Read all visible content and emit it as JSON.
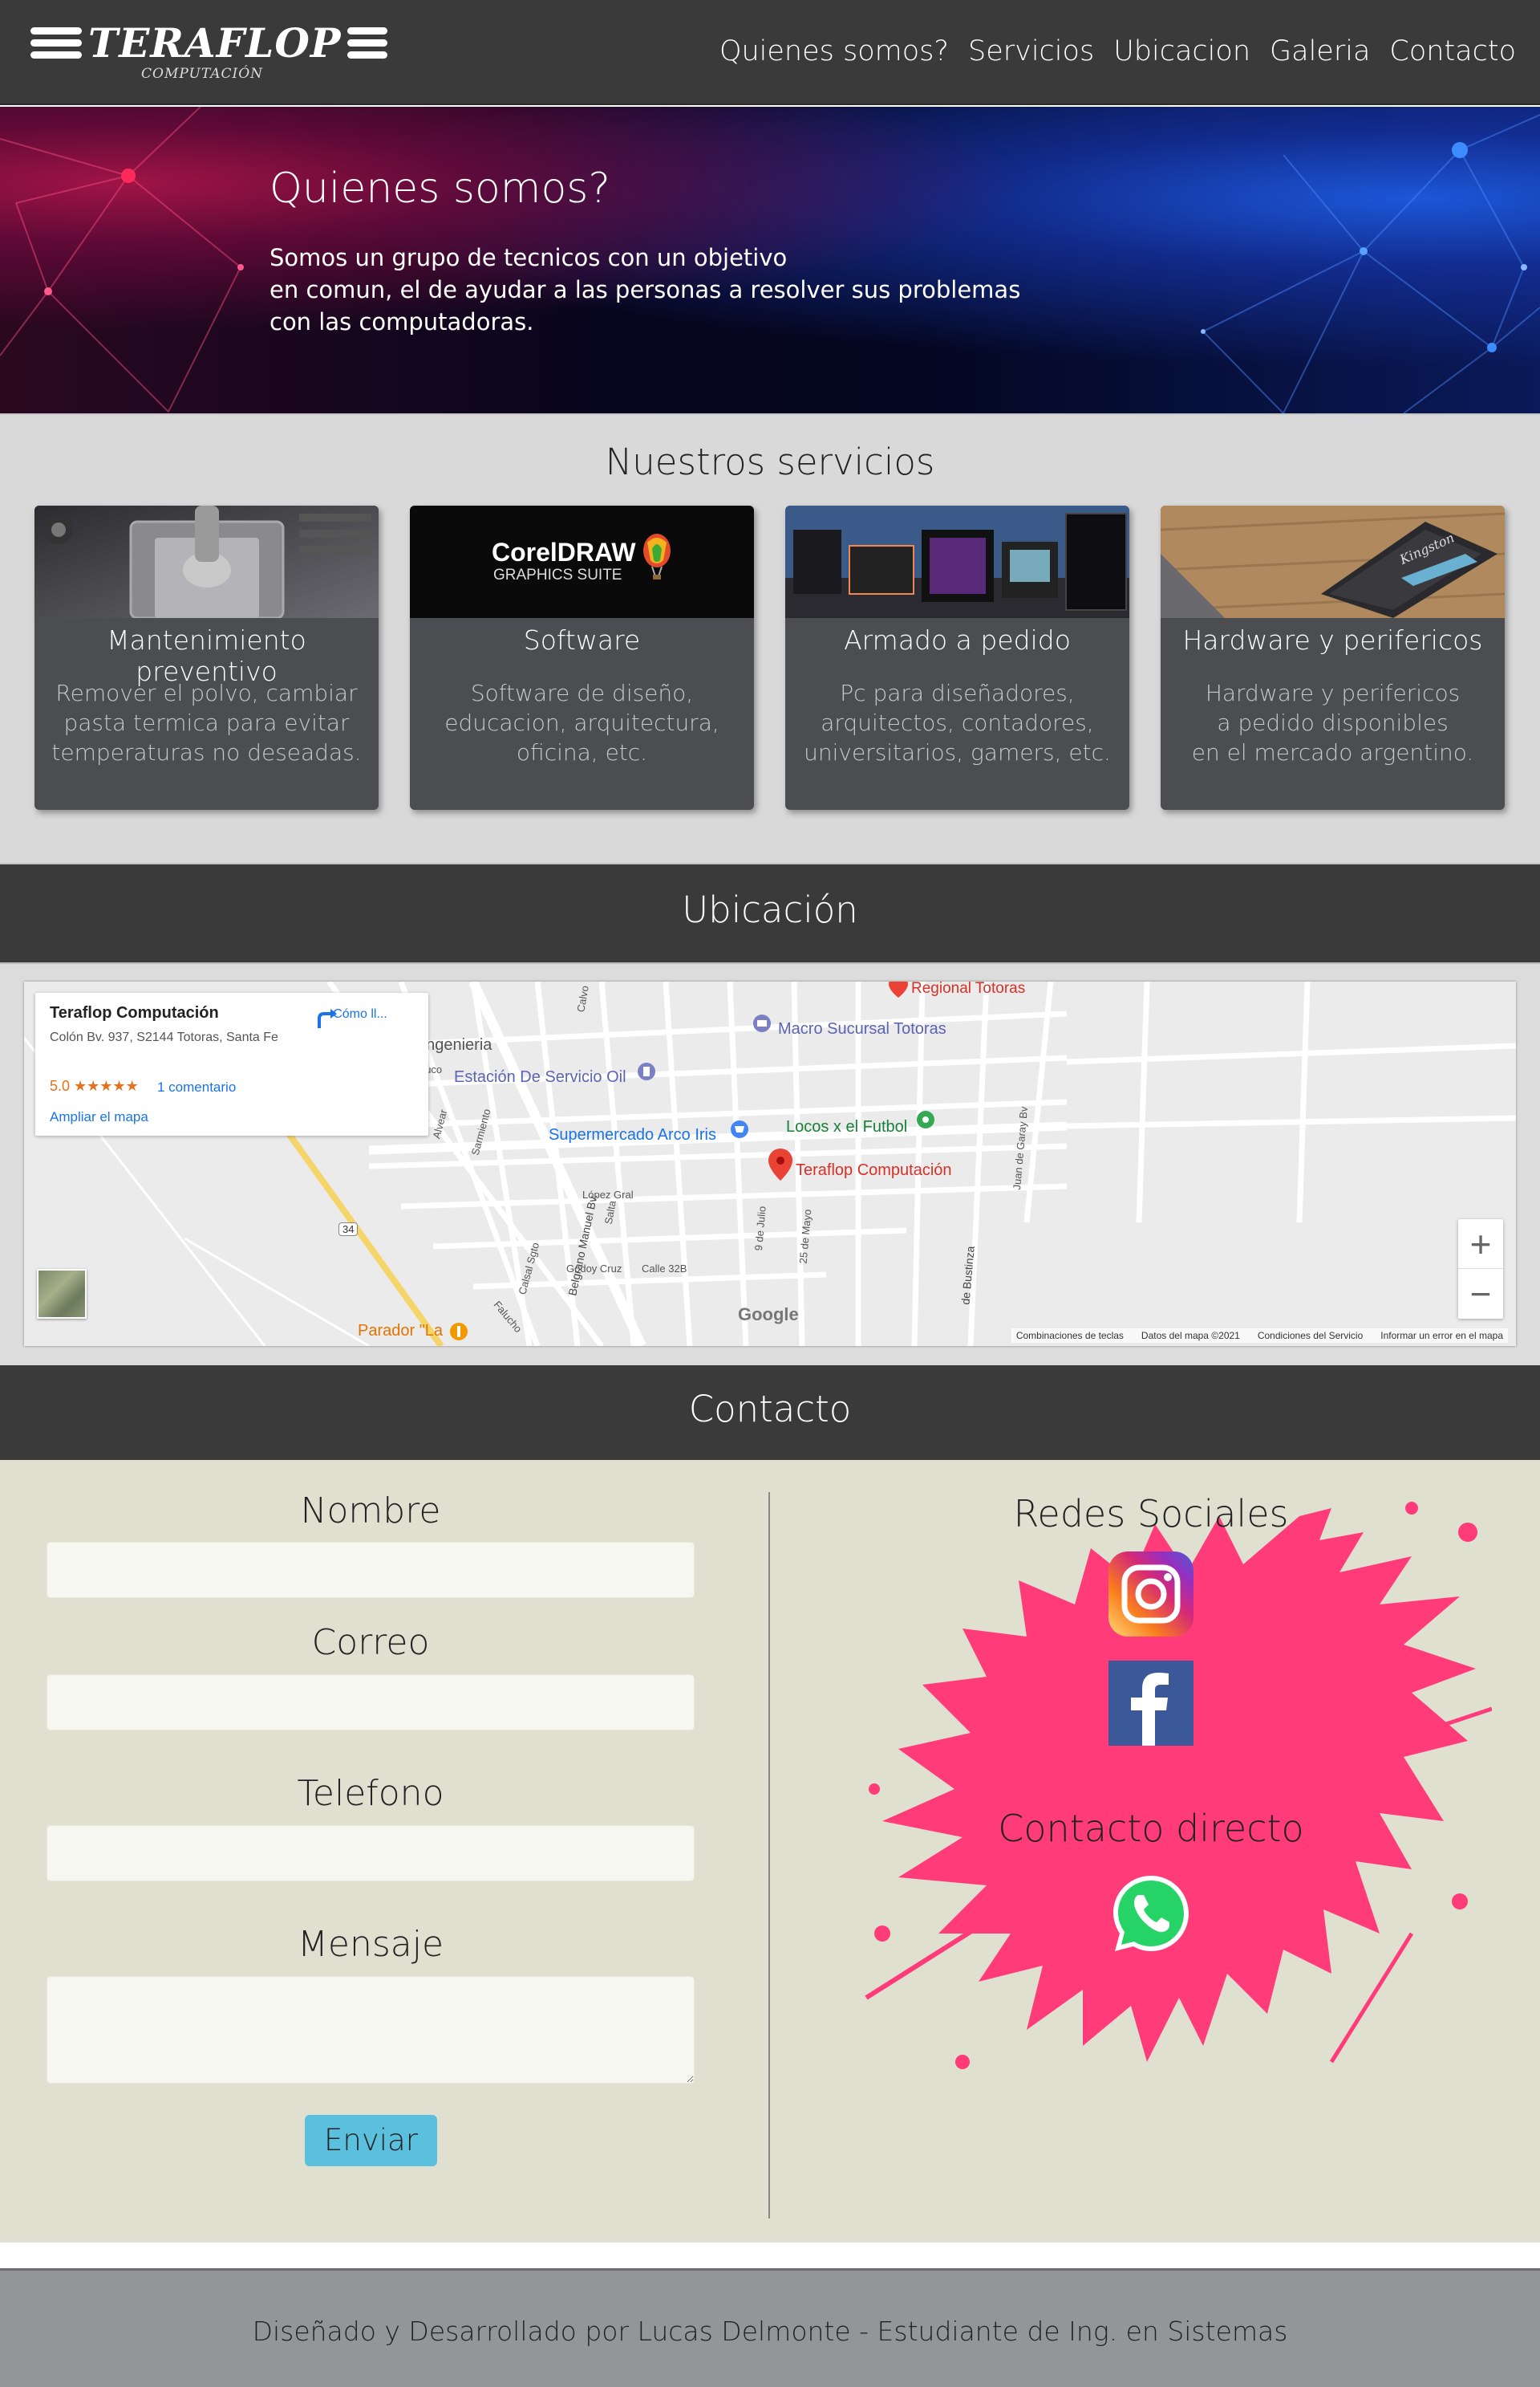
{
  "brand": {
    "name": "TERAFLOP",
    "tagline": "COMPUTACIÓN"
  },
  "nav": {
    "items": [
      {
        "label": "Quienes somos?"
      },
      {
        "label": "Servicios"
      },
      {
        "label": "Ubicacion"
      },
      {
        "label": "Galeria"
      },
      {
        "label": "Contacto"
      }
    ]
  },
  "hero": {
    "title": "Quienes somos?",
    "lines": [
      "Somos un grupo de tecnicos con un objetivo",
      "en comun, el de ayudar a las personas a resolver sus problemas",
      "con las computadoras."
    ]
  },
  "services": {
    "title": "Nuestros servicios",
    "cards": [
      {
        "title": "Mantenimiento preventivo",
        "desc": [
          "Remover el polvo, cambiar",
          "pasta termica para evitar",
          "temperaturas no deseadas."
        ]
      },
      {
        "title": "Software",
        "image_text": "CorelDRAW",
        "image_subtext": "GRAPHICS SUITE",
        "desc": [
          "Software de diseño,",
          "educacion, arquitectura,",
          "oficina, etc."
        ]
      },
      {
        "title": "Armado a pedido",
        "desc": [
          "Pc para diseñadores,",
          "arquitectos, contadores,",
          "universitarios, gamers, etc."
        ]
      },
      {
        "title": "Hardware y perifericos",
        "image_text": "Kingston",
        "desc": [
          "Hardware y perifericos",
          "a pedido disponibles",
          "en el mercado argentino."
        ]
      }
    ]
  },
  "location": {
    "title": "Ubicación",
    "map": {
      "place_name": "Teraflop Computación",
      "address": "Colón Bv. 937, S2144 Totoras, Santa Fe",
      "rating": "5.0 ★★★★★",
      "reviews": "1 comentario",
      "enlarge": "Ampliar el mapa",
      "directions": "Cómo ll...",
      "labels": {
        "regional": "Regional Totoras",
        "macro": "Macro Sucursal Totoras",
        "ingenieria": "ck Ingenieria",
        "estacion": "Estación De Servicio Oil",
        "supermercado": "Supermercado Arco Iris",
        "locos": "Locos x el Futbol",
        "teraflop": "Teraflop Computación",
        "parador": "Parador \"La",
        "route": "34",
        "belgrano": "Belgrano Manuel Bv.",
        "bustinza": "de Bustinza",
        "calle": "Calle 32B",
        "godoy": "Godoy Cruz",
        "lopez": "López Gral",
        "salta": "Salta",
        "julio": "9 de Julio",
        "mayo": "25 de Mayo",
        "garay": "Juan de Garay Bv",
        "alvear": "Alvear",
        "sarmiento": "Sarmiento",
        "falucho": "Falucho",
        "chacabuco": "acabuco",
        "calvo": "Calvo",
        "calsal": "Calsal Sgto"
      },
      "zoom_in": "+",
      "zoom_out": "−",
      "google": "Google",
      "footer": [
        "Combinaciones de teclas",
        "Datos del mapa ©2021",
        "Condiciones del Servicio",
        "Informar un error en el mapa"
      ]
    }
  },
  "contact": {
    "title": "Contacto",
    "form": {
      "name_label": "Nombre",
      "email_label": "Correo",
      "phone_label": "Telefono",
      "message_label": "Mensaje",
      "submit_label": "Enviar"
    },
    "social_title": "Redes Sociales",
    "direct_title": "Contacto directo",
    "icons": [
      "instagram-icon",
      "facebook-icon",
      "whatsapp-icon"
    ],
    "colors": {
      "splash": "#ff3b7a",
      "whatsapp": "#25d366",
      "facebook": "#3b5998",
      "button": "#5bc0de"
    }
  },
  "footer": {
    "text": "Diseñado y Desarrollado por Lucas Delmonte - Estudiante de Ing. en Sistemas"
  }
}
